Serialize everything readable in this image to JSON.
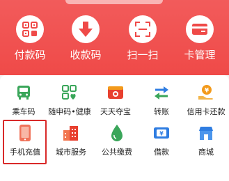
{
  "quick_actions": [
    {
      "label": "付款码",
      "icon": "payment-qr-icon"
    },
    {
      "label": "收款码",
      "icon": "receive-arrow-icon"
    },
    {
      "label": "扫一扫",
      "icon": "scan-icon"
    },
    {
      "label": "卡管理",
      "icon": "card-icon"
    }
  ],
  "services": [
    {
      "label": "乘车码",
      "icon": "bus-icon"
    },
    {
      "label": "随申码•健康",
      "icon": "health-qr-icon"
    },
    {
      "label": "天天夺宝",
      "icon": "treasure-icon"
    },
    {
      "label": "转账",
      "icon": "transfer-icon"
    },
    {
      "label": "信用卡还款",
      "icon": "credit-repay-icon"
    },
    {
      "label": "手机充值",
      "icon": "phone-icon"
    },
    {
      "label": "城市服务",
      "icon": "city-icon"
    },
    {
      "label": "公共缴费",
      "icon": "drop-icon"
    },
    {
      "label": "借款",
      "icon": "loan-icon"
    },
    {
      "label": "商城",
      "icon": "mall-icon"
    }
  ],
  "colors": {
    "header_red": "#ef4a48",
    "highlight": "#d92a2a",
    "green": "#3aa65a",
    "blue": "#2f7de1",
    "orange": "#f39a1b"
  }
}
